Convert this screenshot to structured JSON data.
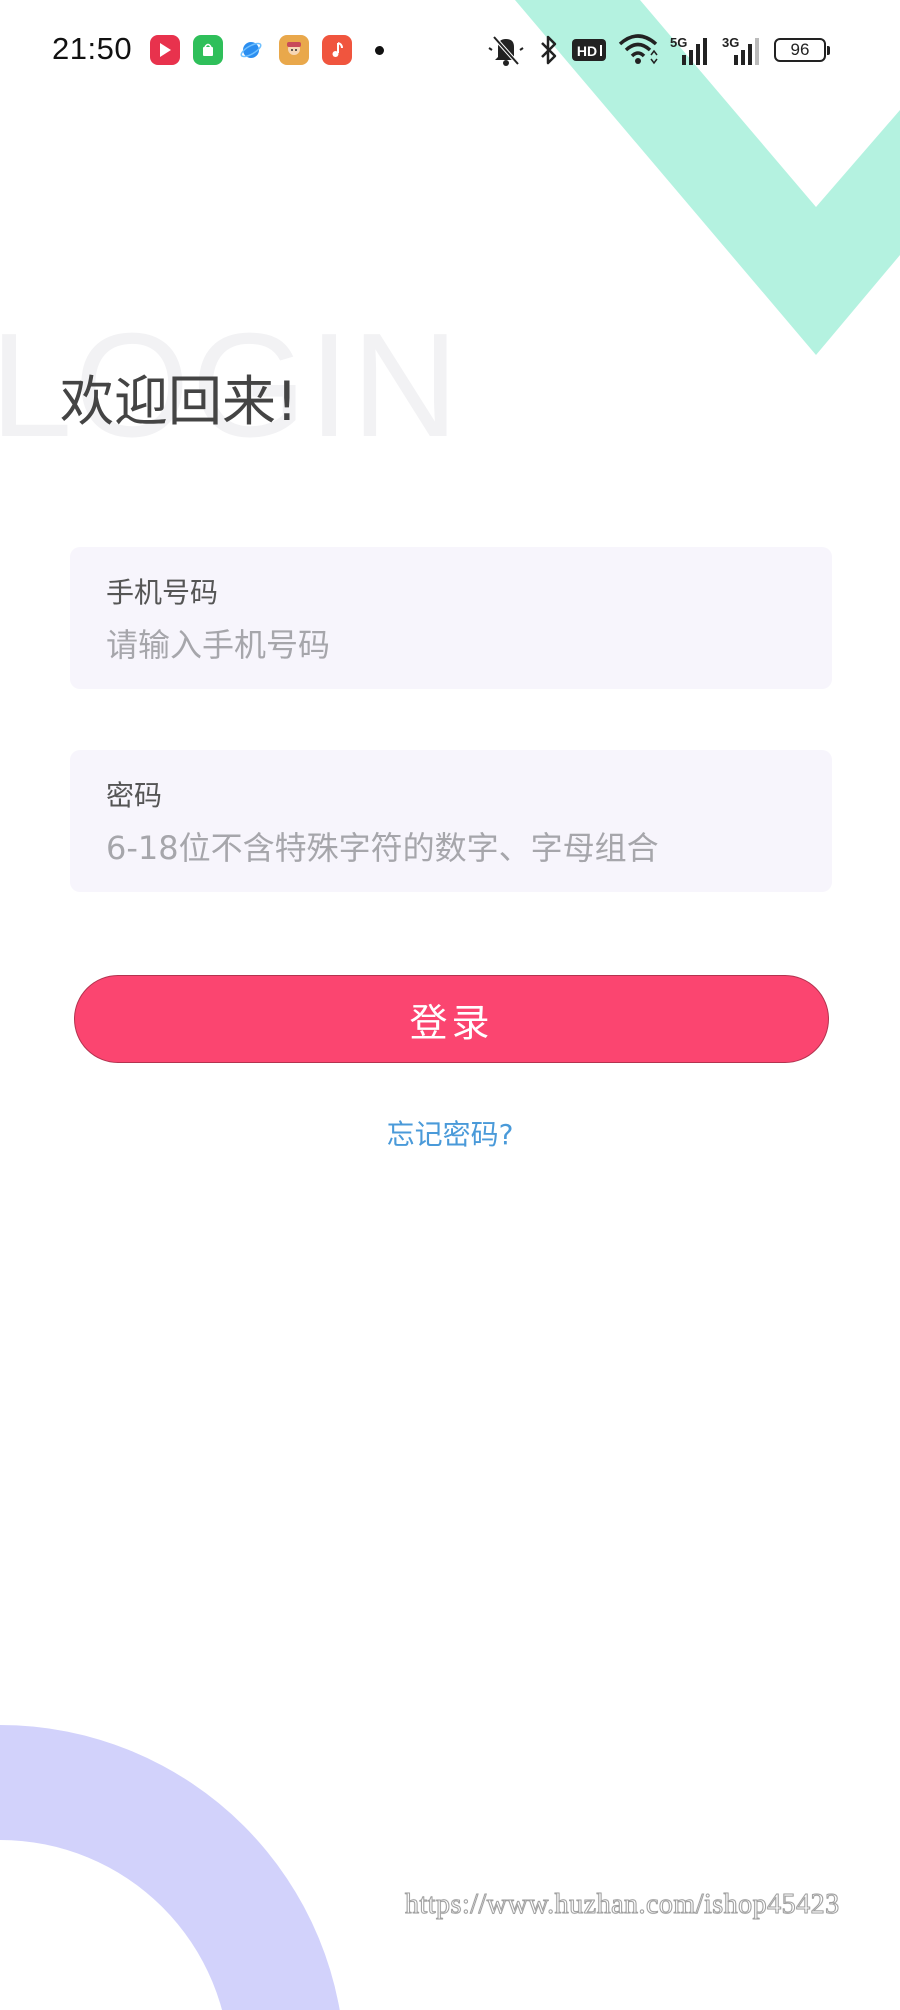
{
  "status_bar": {
    "time": "21:50",
    "battery": "96",
    "network_5g": "5G",
    "network_3g": "3G",
    "hd": "HD"
  },
  "login": {
    "watermark": "LOGIN",
    "title": "欢迎回来!",
    "phone": {
      "label": "手机号码",
      "placeholder": "请输入手机号码",
      "value": ""
    },
    "password": {
      "label": "密码",
      "placeholder": "6-18位不含特殊字符的数字、字母组合",
      "value": ""
    },
    "submit_label": "登录",
    "forgot_label": "忘记密码?"
  },
  "site_watermark": "https://www.huzhan.com/ishop45423",
  "colors": {
    "accent": "#fb4570",
    "link": "#4a9ad9",
    "deco_top": "#b4f2e0",
    "deco_bottom": "#d2d2fb",
    "field_bg": "#f7f5fc"
  }
}
